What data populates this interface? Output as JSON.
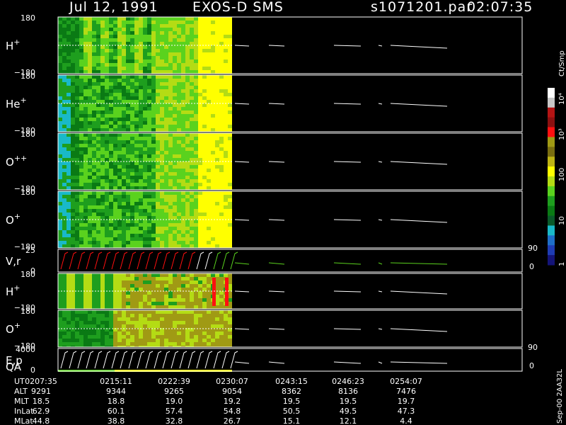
{
  "header": {
    "date": "Jul 12, 1991",
    "instrument": "EXOS-D SMS",
    "file": "s1071201.par",
    "time": "02:07:35"
  },
  "chart_data": {
    "type": "heatmap",
    "colorbar": {
      "unit_label": "Ct/Smp",
      "ticks": [
        "10⁴",
        "10³",
        "100",
        "10",
        "1"
      ],
      "scale": "log"
    },
    "panels": [
      {
        "label_base": "H",
        "label_sup": "+",
        "y_top": "180",
        "y_bottom": "−180"
      },
      {
        "label_base": "He",
        "label_sup": "+",
        "y_top": "180",
        "y_bottom": "−180"
      },
      {
        "label_base": "O",
        "label_sup": "++",
        "y_top": "180",
        "y_bottom": "−180"
      },
      {
        "label_base": "O",
        "label_sup": "+",
        "y_top": "180",
        "y_bottom": "−180"
      },
      {
        "label_base": "V,r",
        "label_sup": "",
        "y_top": "25",
        "y_bottom": "0",
        "right_top": "90",
        "right_bottom": "0"
      },
      {
        "label_base": "H",
        "label_sup": "+",
        "y_top": "180",
        "y_bottom": "−180"
      },
      {
        "label_base": "O",
        "label_sup": "+",
        "y_top": "180",
        "y_bottom": "−180"
      },
      {
        "label_base": "E,p",
        "label_sup": "",
        "label2": "QA",
        "y_top": "4000",
        "y_bottom": "0",
        "right_top": "90",
        "right_bottom": "0"
      }
    ],
    "orbit_table": {
      "rows": [
        {
          "name": "UT",
          "values": [
            "0207:35",
            "0215:11",
            "0222:39",
            "0230:07",
            "0243:15",
            "0246:23",
            "0254:07"
          ]
        },
        {
          "name": "ALT",
          "values": [
            "9291",
            "9344",
            "9265",
            "9054",
            "8362",
            "8136",
            "7476"
          ]
        },
        {
          "name": "MLT",
          "values": [
            "18.5",
            "18.8",
            "19.0",
            "19.2",
            "19.5",
            "19.5",
            "19.7"
          ]
        },
        {
          "name": "InLat",
          "values": [
            "62.9",
            "60.1",
            "57.4",
            "54.8",
            "50.5",
            "49.5",
            "47.3"
          ]
        },
        {
          "name": "MLat",
          "values": [
            "44.8",
            "38.8",
            "32.8",
            "26.7",
            "15.1",
            "12.1",
            "4.4"
          ]
        }
      ]
    },
    "footer_label": "Sep-00 2AA32L",
    "colors": {
      "black": "#000000",
      "cyan": "#19b9c8",
      "dkgreen": "#0a7a14",
      "green": "#1e9e1e",
      "ltgreen": "#5ad21e",
      "yellowgreen": "#b4dc14",
      "yellow": "#ffff00",
      "olive": "#a09a14",
      "red": "#ff1010",
      "white": "#ffffff"
    }
  }
}
